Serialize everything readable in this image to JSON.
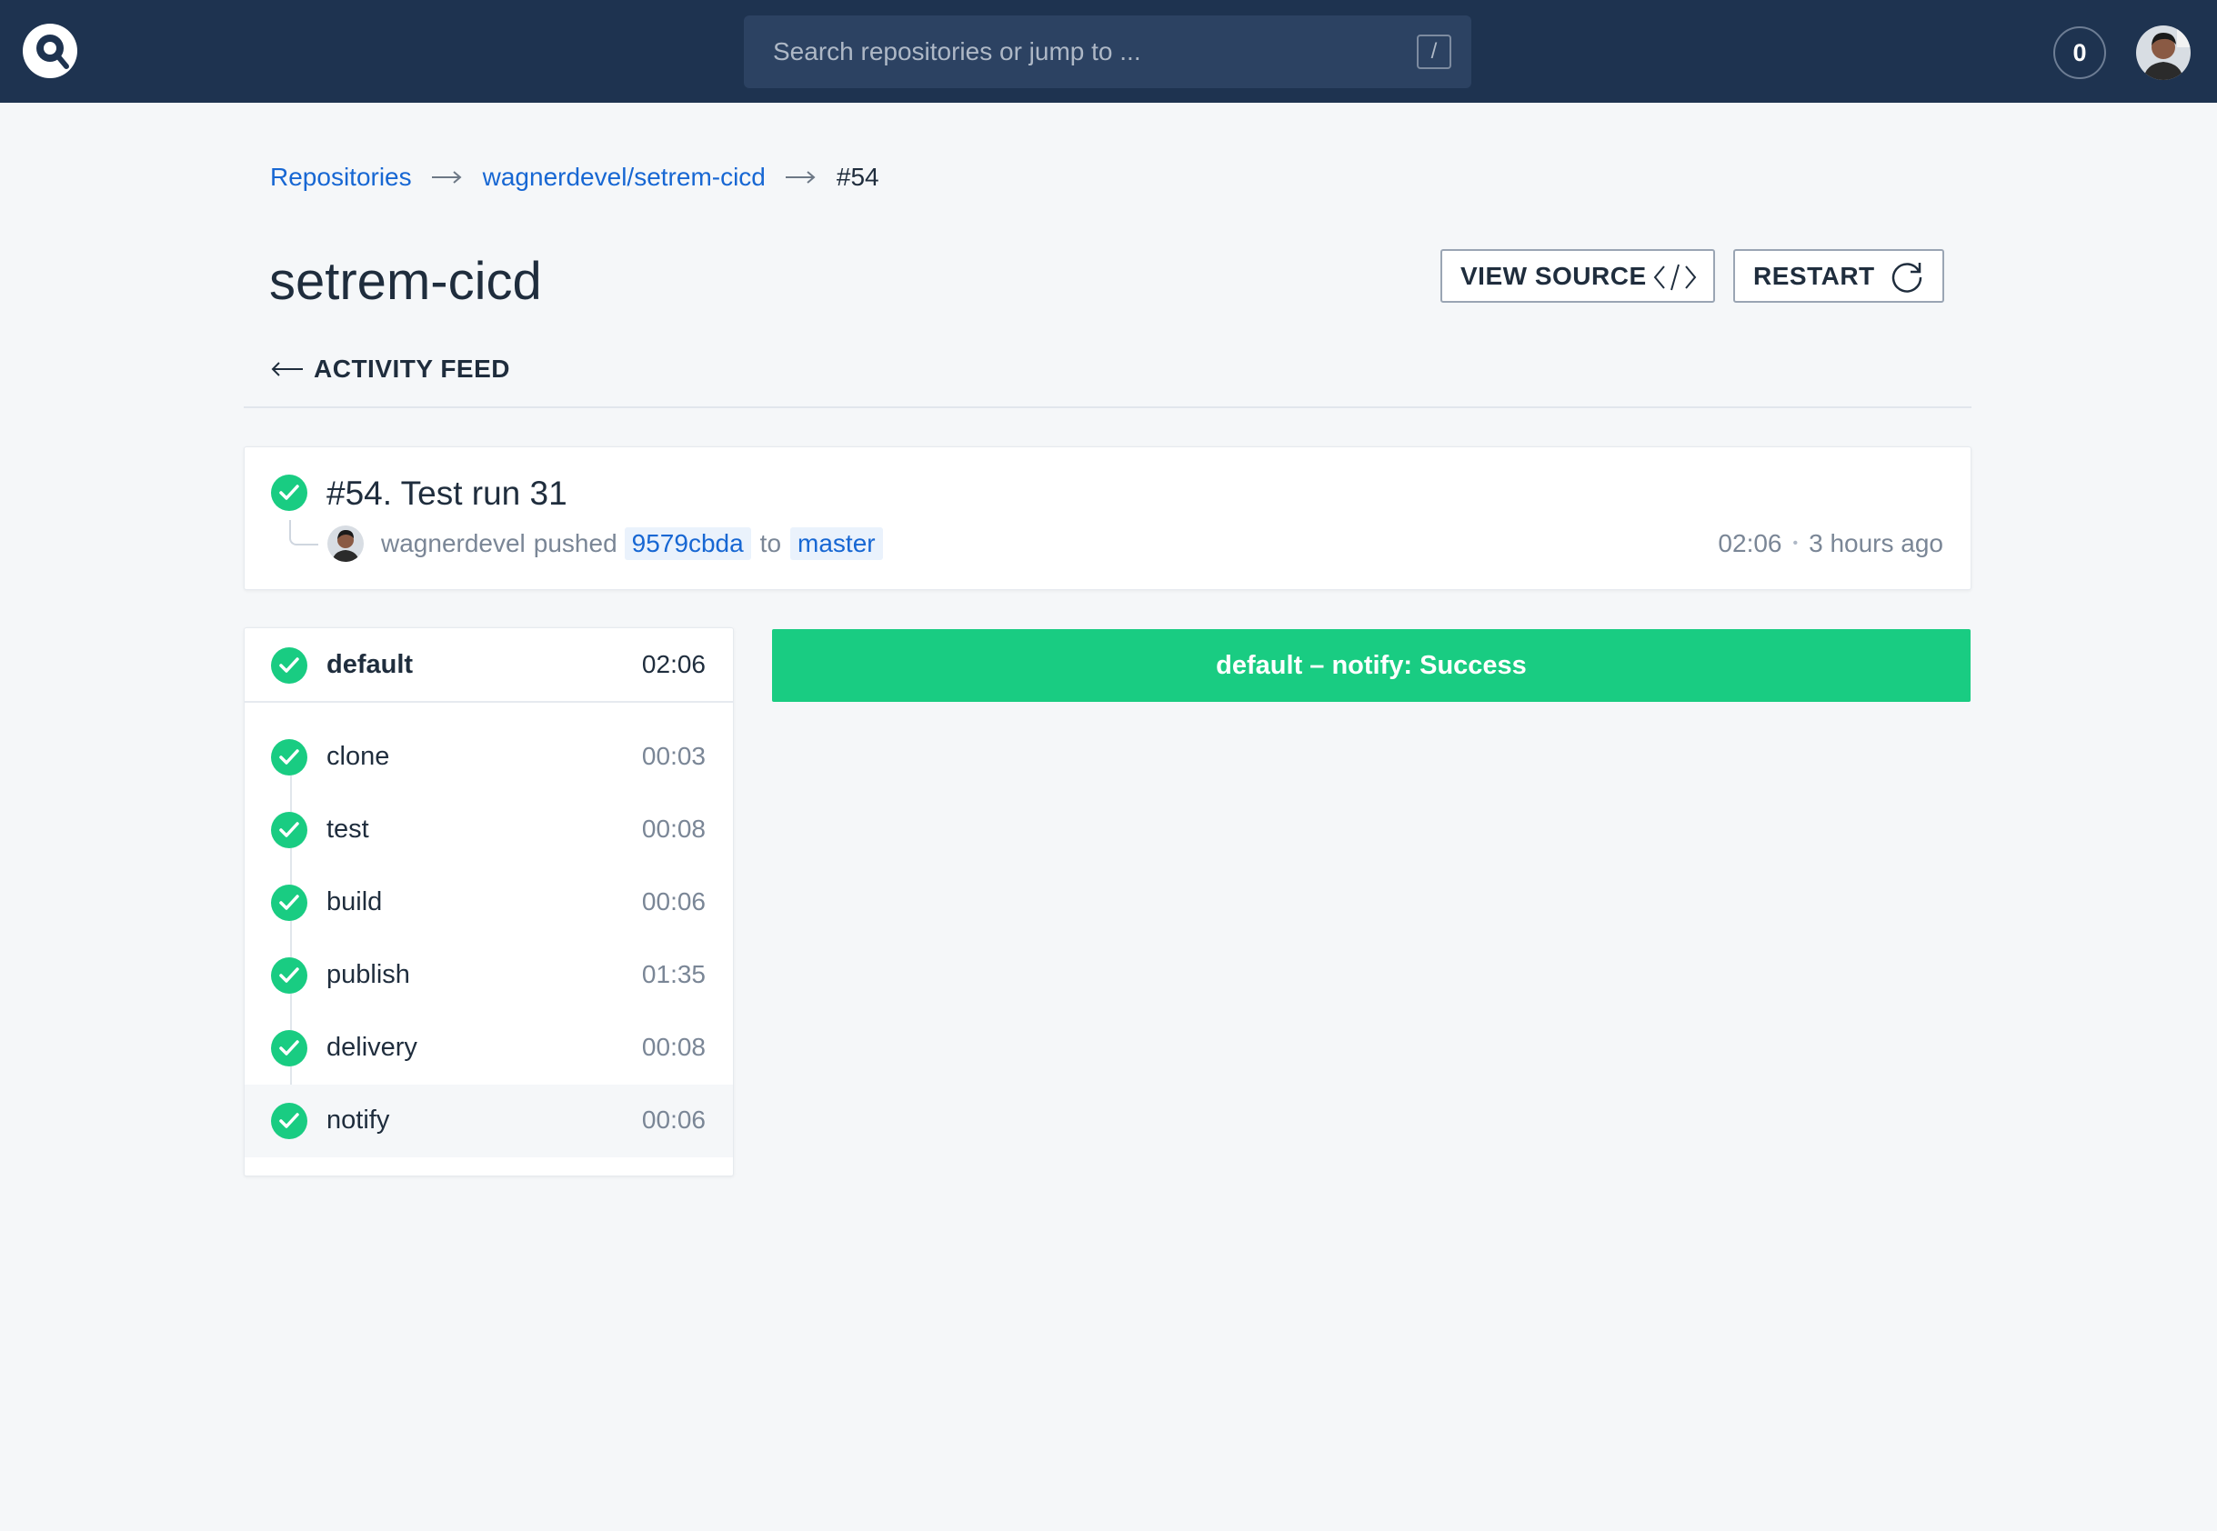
{
  "topbar": {
    "search_placeholder": "Search repositories or jump to ...",
    "search_shortcut": "/",
    "notification_count": "0"
  },
  "breadcrumb": {
    "items": [
      "Repositories",
      "wagnerdevel/setrem-cicd",
      "#54"
    ]
  },
  "repo": {
    "title": "setrem-cicd",
    "view_source_label": "VIEW SOURCE",
    "restart_label": "RESTART",
    "back_label": "ACTIVITY FEED"
  },
  "build": {
    "title": "#54. Test run 31",
    "author": "wagnerdevel",
    "action": "pushed",
    "commit": "9579cbda",
    "to_word": "to",
    "branch": "master",
    "duration": "02:06",
    "separator": "•",
    "started": "3 hours ago",
    "status": "success"
  },
  "pipeline": {
    "name": "default",
    "duration": "02:06",
    "steps": [
      {
        "name": "clone",
        "duration": "00:03"
      },
      {
        "name": "test",
        "duration": "00:08"
      },
      {
        "name": "build",
        "duration": "00:06"
      },
      {
        "name": "publish",
        "duration": "01:35"
      },
      {
        "name": "delivery",
        "duration": "00:08"
      },
      {
        "name": "notify",
        "duration": "00:06"
      }
    ],
    "selected_step": "notify"
  },
  "banner": {
    "text": "default – notify: Success"
  },
  "colors": {
    "topbar": "#1e3350",
    "success": "#19cc82",
    "link": "#1767d3"
  }
}
